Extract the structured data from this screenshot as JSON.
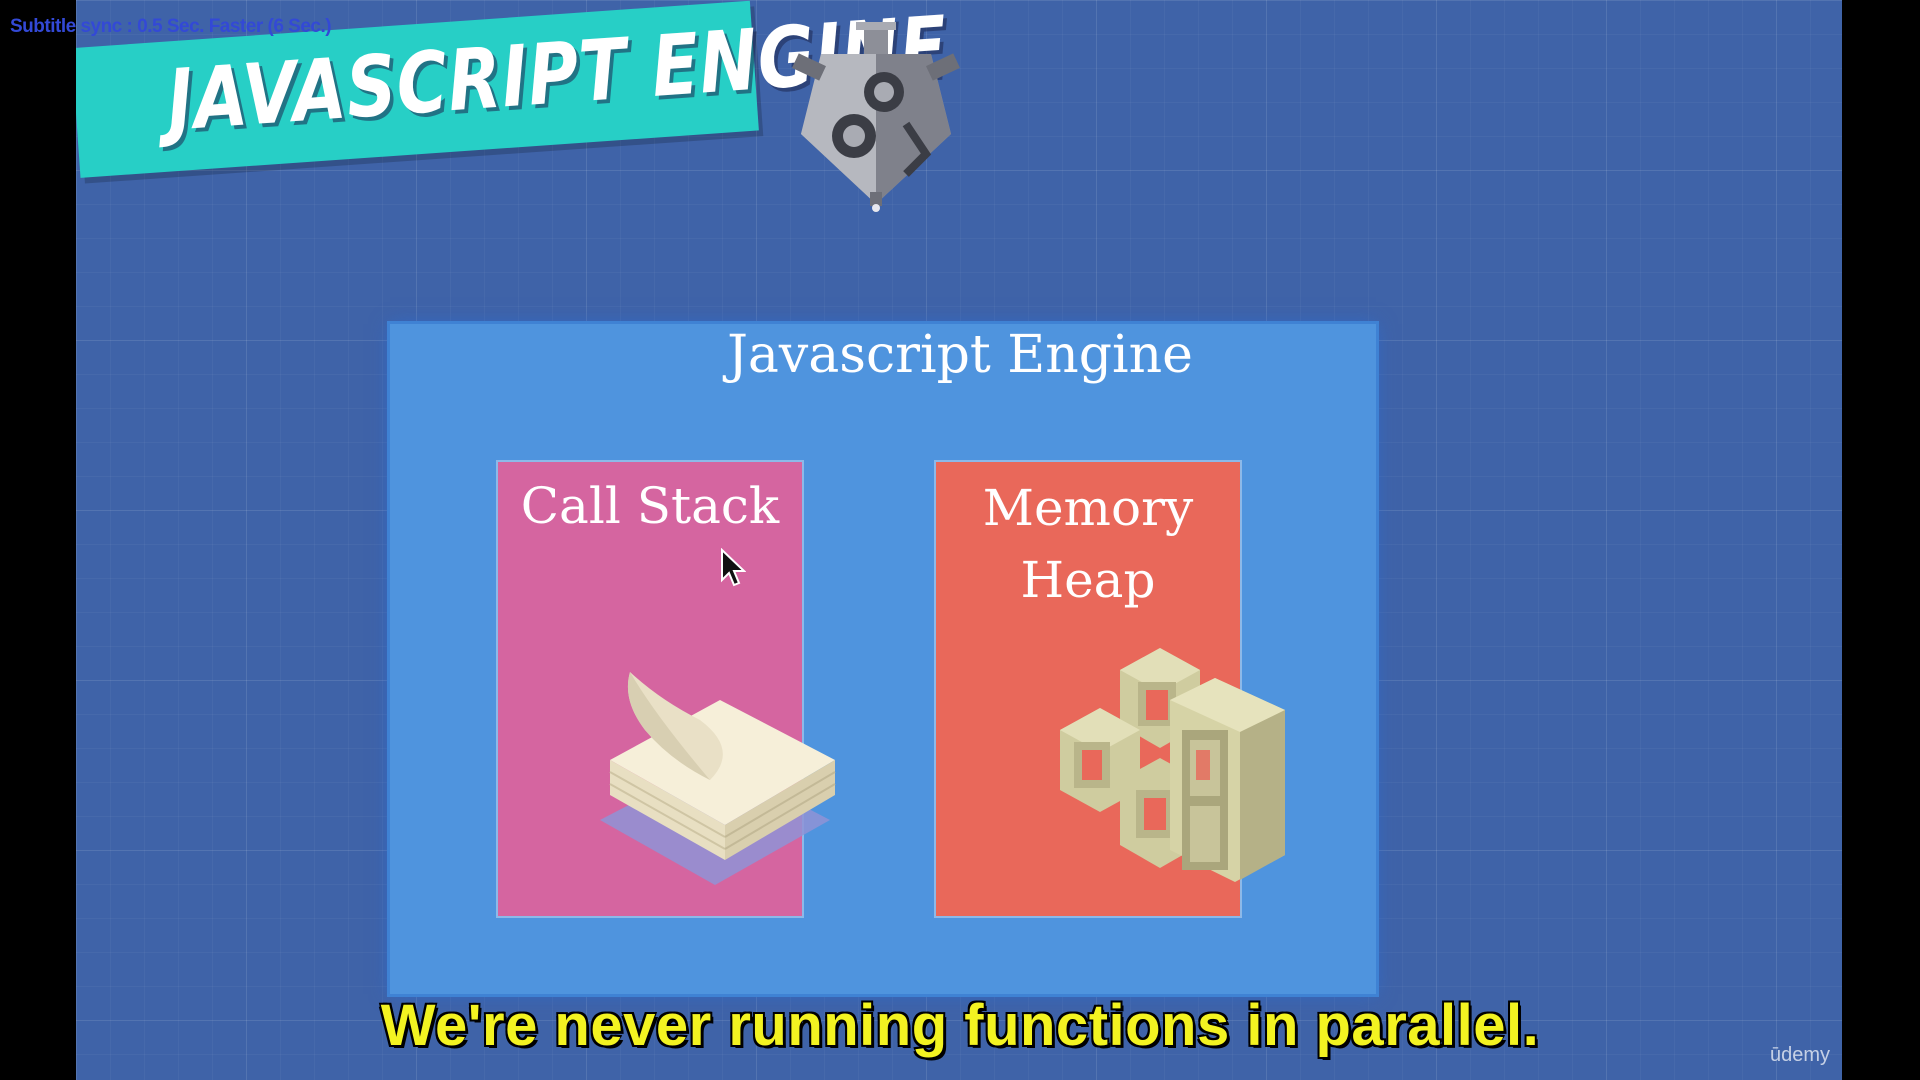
{
  "player": {
    "subtitle_sync": "Subtitle sync : 0.5 Sec. Faster (6 Sec.)",
    "subtitle_line": "We're never running functions in parallel.",
    "watermark": "ūdemy"
  },
  "slide": {
    "banner_title": "JAVASCRIPT ENGINE",
    "panel_title": "Javascript Engine",
    "cards": [
      {
        "title_line1": "Call Stack",
        "title_line2": "",
        "icon": "paper-stack-icon",
        "color": "#d565a0"
      },
      {
        "title_line1": "Memory",
        "title_line2": "Heap",
        "icon": "boxes-icon",
        "color": "#e9685a"
      }
    ],
    "colors": {
      "background": "#3f63a8",
      "banner": "#27cfc6",
      "panel": "#4f94de",
      "subtitle": "#f3f321"
    }
  }
}
